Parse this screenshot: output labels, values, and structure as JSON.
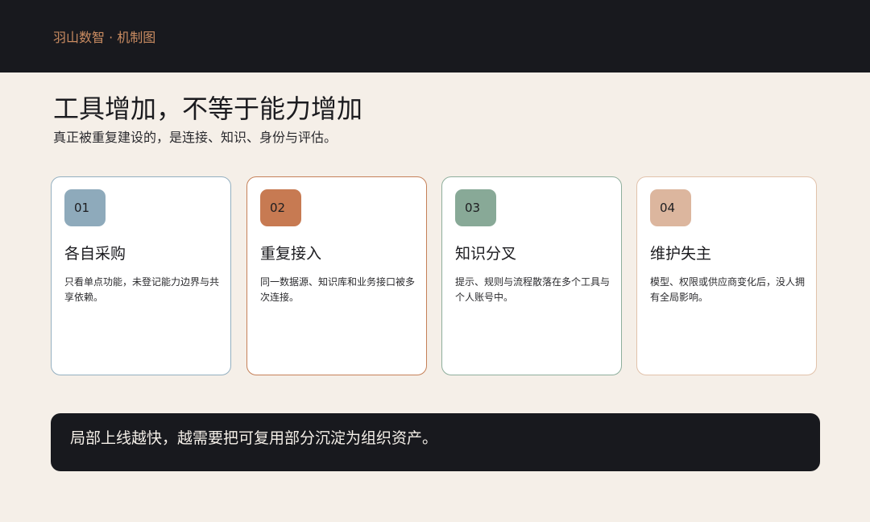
{
  "header": {
    "brand": "羽山数智 · 机制图"
  },
  "main": {
    "title": "工具增加，不等于能力增加",
    "subtitle": "真正被重复建设的，是连接、知识、身份与评估。"
  },
  "cards": [
    {
      "number": "01",
      "title": "各自采购",
      "desc": "只看单点功能，未登记能力边界与共享依赖。",
      "accent": "#8eaabb",
      "border": "#93afc0"
    },
    {
      "number": "02",
      "title": "重复接入",
      "desc": "同一数据源、知识库和业务接口被多次连接。",
      "accent": "#c77a52",
      "border": "#c58058"
    },
    {
      "number": "03",
      "title": "知识分叉",
      "desc": "提示、规则与流程散落在多个工具与个人账号中。",
      "accent": "#88a997",
      "border": "#8eae9c"
    },
    {
      "number": "04",
      "title": "维护失主",
      "desc": "模型、权限或供应商变化后，没人拥有全局影响。",
      "accent": "#dcb69e",
      "border": "#e1c2ab"
    }
  ],
  "footer": {
    "text": "局部上线越快，越需要把可复用部分沉淀为组织资产。"
  }
}
